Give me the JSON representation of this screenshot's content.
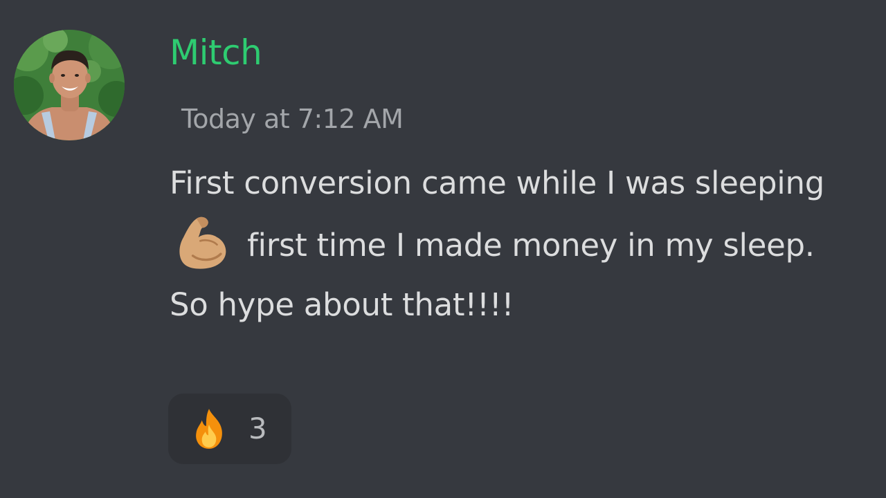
{
  "message": {
    "author": "Mitch",
    "author_color": "#2ecc71",
    "timestamp": "Today at 7:12 AM",
    "content_before_emoji": "First conversion came while I was sleeping",
    "inline_emoji": "flexed-biceps-icon",
    "content_after_emoji": "first time I made money in my sleep. So hype about that!!!!",
    "reaction": {
      "emoji": "fire-icon",
      "count": "3"
    }
  },
  "colors": {
    "background": "#36393f",
    "text": "#dcddde",
    "timestamp": "#a3a6aa",
    "reaction_bg": "#2f3136"
  }
}
